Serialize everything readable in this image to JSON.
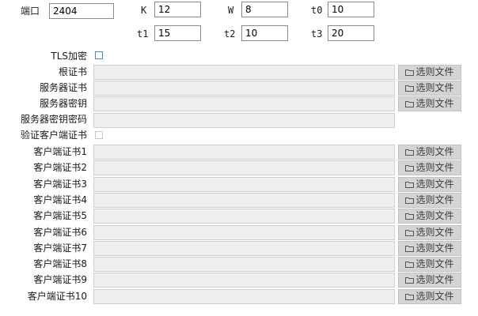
{
  "params": {
    "port_label": "端口",
    "port_value": "2404",
    "k_label": "K",
    "k_value": "12",
    "w_label": "W",
    "w_value": "8",
    "t0_label": "t0",
    "t0_value": "10",
    "t1_label": "t1",
    "t1_value": "15",
    "t2_label": "t2",
    "t2_value": "10",
    "t3_label": "t3",
    "t3_value": "20"
  },
  "tls": {
    "tls_label": "TLS加密",
    "root_cert_label": "根证书",
    "server_cert_label": "服务器证书",
    "server_key_label": "服务器密钥",
    "server_key_password_label": "服务器密钥密码",
    "verify_client_label": "验证客户端证书",
    "choose_file_label": "选则文件",
    "client_certs": [
      "客户端证书1",
      "客户端证书2",
      "客户端证书3",
      "客户端证书4",
      "客户端证书5",
      "客户端证书6",
      "客户端证书7",
      "客户端证书8",
      "客户端证书9",
      "客户端证书10"
    ]
  },
  "colors": {
    "checkbox_border": "#4a86c8",
    "button_bg": "#d4d4d4",
    "field_bg": "#efefef"
  }
}
